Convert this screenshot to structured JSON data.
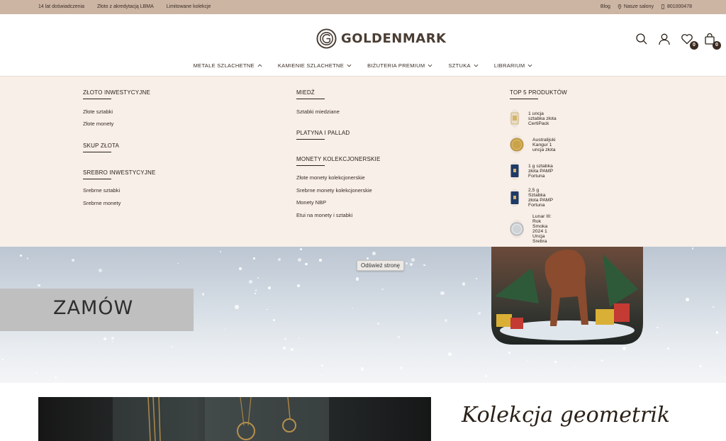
{
  "topbar": {
    "left_items": [
      "14 lat doświadczenia",
      "Złoto z akredytacją LBMA",
      "Limitowane kolekcje"
    ],
    "blog": "Blog",
    "salons": "Nasze salony",
    "phone": "801000478"
  },
  "header": {
    "logo_text": "GOLDENMARK",
    "wishlist_count": "0",
    "cart_count": "0"
  },
  "nav": {
    "items": [
      "METALE SZLACHETNE",
      "KAMIENIE SZLACHETNE",
      "BIŻUTERIA PREMIUM",
      "SZTUKA",
      "LIBRARIUM"
    ]
  },
  "mega": {
    "col1": {
      "s1_title": "ZŁOTO INWESTYCYJNE",
      "s1_links": [
        "Złote sztabki",
        "Złote monety"
      ],
      "s2_title": "SKUP ZŁOTA",
      "s3_title": "SREBRO INWESTYCYJNE",
      "s3_links": [
        "Srebrne sztabki",
        "Srebrne monety"
      ]
    },
    "col2": {
      "s1_title": "MIEDŹ",
      "s1_links": [
        "Sztabki miedziane"
      ],
      "s2_title": "PLATYNA I PALLAD",
      "s3_title": "MONETY KOLEKCJONERSKIE",
      "s3_links": [
        "Złote monety kolekcjonerskie",
        "Srebrne monety kolekcjonerskie",
        "Monety NBP",
        "Etui na monety i sztabki"
      ]
    },
    "col3": {
      "title": "TOP 5 PRODUKTÓW",
      "products": [
        "1 uncja sztabka złota CertiPack",
        "Australijski Kangur 1 uncja złota",
        "1 g sztabka złota PAMP Fortuna",
        "2,5 g Sztabka złota PAMP Fortuna",
        "Lunar III: Rok Smoka 2024 1 Uncja Srebra"
      ]
    }
  },
  "hero": {
    "cta": "ZAMÓW",
    "tooltip": "Odśwież stronę"
  },
  "collection": {
    "title": "Kolekcja geometrik"
  },
  "colors": {
    "topbar": "#cdb5a4",
    "mega_bg": "#f8efe9",
    "text_dark": "#2b2118"
  }
}
